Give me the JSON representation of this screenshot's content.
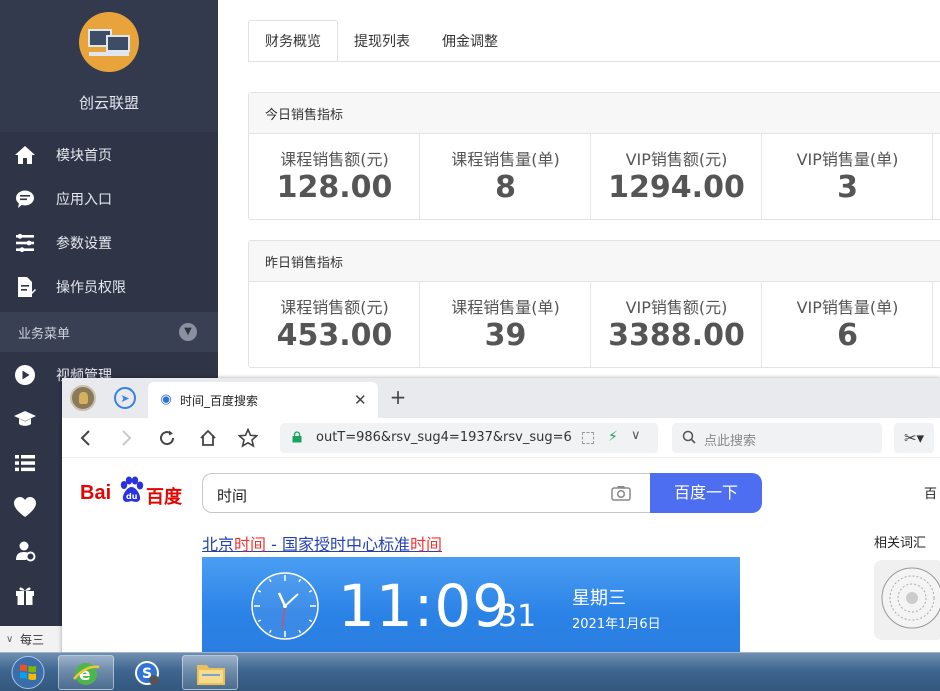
{
  "sidebar": {
    "brand": "创云联盟",
    "items": [
      {
        "label": "模块首页",
        "icon": "home-icon"
      },
      {
        "label": "应用入口",
        "icon": "chat-bubble-icon"
      },
      {
        "label": "参数设置",
        "icon": "list-settings-icon"
      },
      {
        "label": "操作员权限",
        "icon": "document-edit-icon"
      }
    ],
    "group_label": "业务菜单",
    "group_items": [
      {
        "label": "视频管理",
        "icon": "play-circle-icon"
      },
      {
        "label": "",
        "icon": "graduation-cap-icon"
      },
      {
        "label": "",
        "icon": "list-icon"
      },
      {
        "label": "",
        "icon": "heart-icon"
      },
      {
        "label": "",
        "icon": "user-settings-icon"
      },
      {
        "label": "",
        "icon": "gift-icon"
      }
    ],
    "submenu_label": "每三"
  },
  "main": {
    "tabs": [
      "财务概览",
      "提现列表",
      "佣金调整"
    ],
    "today": {
      "title": "今日销售指标",
      "stats": [
        {
          "label": "课程销售额(元)",
          "value": "128.00"
        },
        {
          "label": "课程销售量(单)",
          "value": "8"
        },
        {
          "label": "VIP销售额(元)",
          "value": "1294.00"
        },
        {
          "label": "VIP销售量(单)",
          "value": "3"
        }
      ]
    },
    "yesterday": {
      "title": "昨日销售指标",
      "stats": [
        {
          "label": "课程销售额(元)",
          "value": "453.00"
        },
        {
          "label": "课程销售量(单)",
          "value": "39"
        },
        {
          "label": "VIP销售额(元)",
          "value": "3388.00"
        },
        {
          "label": "VIP销售量(单)",
          "value": "6"
        }
      ]
    }
  },
  "browser": {
    "tab_title": "时间_百度搜索",
    "url": "outT=986&rsv_sug4=1937&rsv_sug=6",
    "search_placeholder": "点此搜索",
    "page": {
      "logo_left": "Bai",
      "logo_right": "百度",
      "query": "时间",
      "search_button": "百度一下",
      "top_right": "百",
      "result_title": {
        "p1": "北京",
        "p2": "时间",
        "p3": " - 国家授时中心标准",
        "p4": "时间"
      },
      "related": "相关词汇",
      "clock": {
        "time": "11:09",
        "seconds": "31",
        "weekday": "星期三",
        "date": "2021年1月6日"
      }
    }
  },
  "colors": {
    "sidebar_bg": "#2f3446",
    "baidu_red": "#e10602",
    "baidu_blue": "#4e6ef2",
    "link_blue": "#2440b3",
    "highlight_red": "#f73131",
    "clock_blue": "#2b82e6"
  }
}
